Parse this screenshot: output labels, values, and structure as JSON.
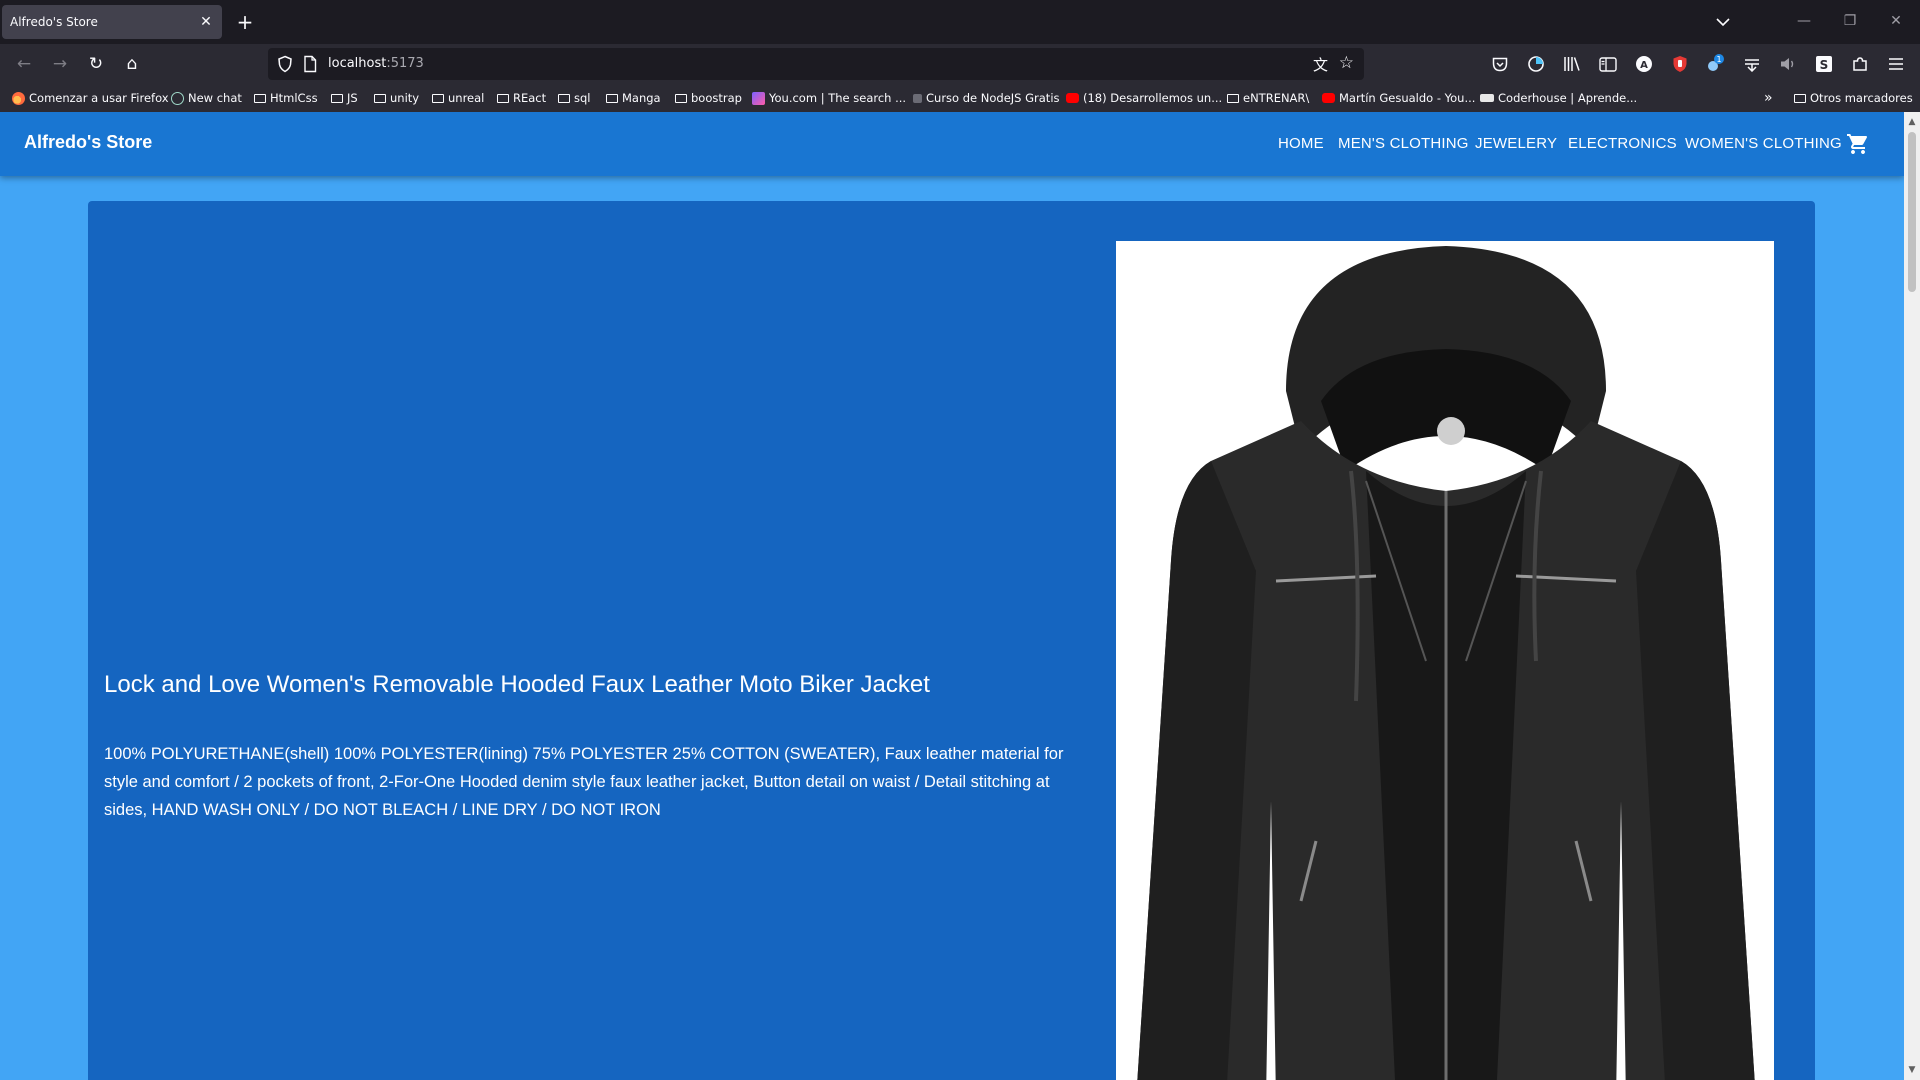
{
  "browser": {
    "tab_title": "Alfredo's Store",
    "close_symbol": "✕",
    "new_tab_symbol": "+",
    "tab_list_symbol": "⌄",
    "window_controls": {
      "minimize": "—",
      "restore": "❐",
      "close": "✕"
    },
    "nav": {
      "back": "←",
      "forward": "→",
      "reload": "↻",
      "home": "⌂"
    },
    "url_host": "localhost",
    "url_port": ":5173",
    "translate_symbol": "文",
    "bookmark_star": "☆",
    "bookmarks": [
      "Comenzar a usar Firefox",
      "New chat",
      "HtmlCss",
      "JS",
      "unity",
      "unreal",
      "REact",
      "sql",
      "Manga",
      "boostrap",
      "You.com | The search ...",
      "Curso de NodeJS Gratis",
      "(18) Desarrollemos un...",
      "eNTRENAR\\",
      "Martín Gesualdo - You...",
      "Coderhouse | Aprende..."
    ],
    "bookmarks_overflow": "»",
    "other_bookmarks": "Otros marcadores",
    "toolbar_badge": "1",
    "toolbar_letter_a": "A",
    "toolbar_letter_s": "S"
  },
  "store": {
    "brand": "Alfredo's Store",
    "menu": [
      "HOME",
      "MEN'S CLOTHING",
      "JEWELERY",
      "ELECTRONICS",
      "WOMEN'S CLOTHING"
    ],
    "product": {
      "title": "Lock and Love Women's Removable Hooded Faux Leather Moto Biker Jacket",
      "description": "100% POLYURETHANE(shell) 100% POLYESTER(lining) 75% POLYESTER 25% COTTON (SWEATER), Faux leather material for style and comfort / 2 pockets of front, 2-For-One Hooded denim style faux leather jacket, Button detail on waist / Detail stitching at sides, HAND WASH ONLY / DO NOT BLEACH / LINE DRY / DO NOT IRON"
    }
  },
  "colors": {
    "appbar": "#1976d2",
    "page_bg": "#42a5f5",
    "card_bg": "#1565c0"
  }
}
